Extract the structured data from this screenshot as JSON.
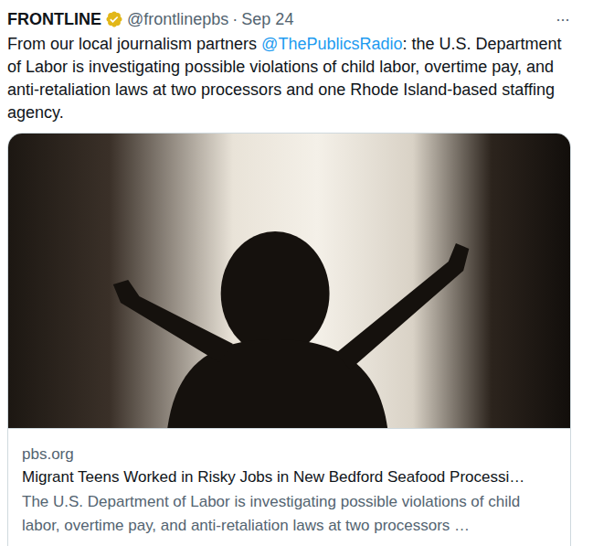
{
  "tweet": {
    "name": "FRONTLINE",
    "verified": true,
    "handle": "@frontlinepbs",
    "separator": "·",
    "date": "Sep 24",
    "more": "···",
    "body": [
      {
        "kind": "text",
        "text": "From our local journalism partners "
      },
      {
        "kind": "mention",
        "text": "@ThePublicsRadio"
      },
      {
        "kind": "text",
        "text": ": the U.S. Department of Labor is investigating possible violations of child labor, overtime pay, and anti-retaliation laws at two processors and one Rhode Island-based staffing agency."
      }
    ],
    "card": {
      "domain": "pbs.org",
      "title": "Migrant Teens Worked in Risky Jobs in New Bedford Seafood Processi…",
      "description": "The U.S. Department of Labor is investigating possible violations of child labor, overtime pay, and anti-retaliation laws at two processors …"
    }
  }
}
